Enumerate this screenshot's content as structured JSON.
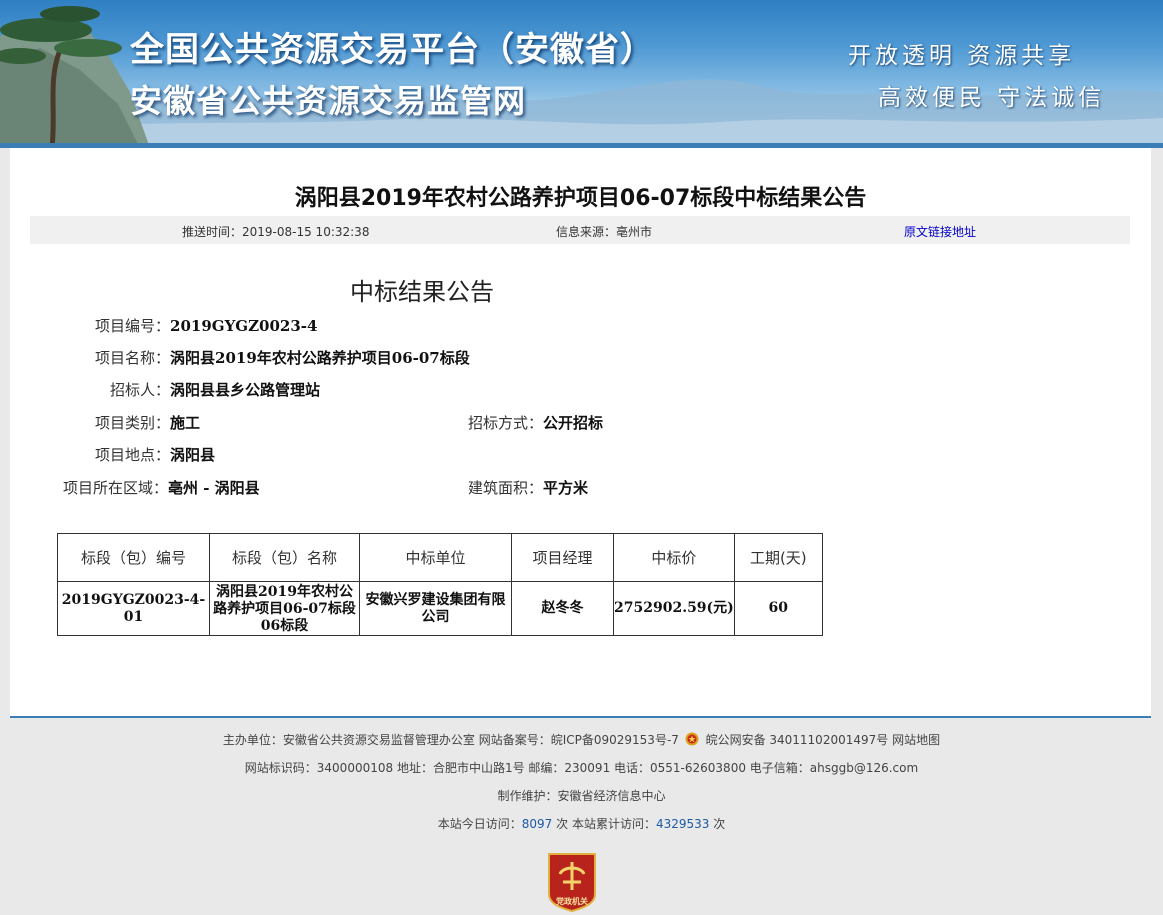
{
  "header": {
    "title": "全国公共资源交易平台（安徽省）",
    "subtitle": "安徽省公共资源交易监管网",
    "slogan_line1": "开放透明  资源共享",
    "slogan_line2": "高效便民  守法诚信"
  },
  "article": {
    "title": "涡阳县2019年农村公路养护项目06-07标段中标结果公告",
    "meta": {
      "push_time": "推送时间：2019-08-15 10:32:38",
      "source": "信息来源：亳州市",
      "original_link": "原文链接地址"
    },
    "notice_title": "中标结果公告",
    "fields": {
      "project_no_label": "项目编号：",
      "project_no": "2019GYGZ0023-4",
      "project_name_label": "项目名称：",
      "project_name": "涡阳县2019年农村公路养护项目06-07标段",
      "tenderer_label": "招标人：",
      "tenderer": "涡阳县县乡公路管理站",
      "category_label": "项目类别：",
      "category": "施工",
      "method_label": "招标方式：",
      "method": "公开招标",
      "location_label": "项目地点：",
      "location": "涡阳县",
      "region_label": "项目所在区域：",
      "region": "亳州 - 涡阳县",
      "area_label": "建筑面积：",
      "area": "平方米"
    },
    "table": {
      "headers": [
        "标段（包）编号",
        "标段（包）名称",
        "中标单位",
        "项目经理",
        "中标价",
        "工期(天)"
      ],
      "row": {
        "section_no": "2019GYGZ0023-4-01",
        "section_name": "涡阳县2019年农村公路养护项目06-07标段06标段",
        "winner": "安徽兴罗建设集团有限公司",
        "manager": "赵冬冬",
        "price": "2752902.59(元)",
        "duration": "60"
      }
    }
  },
  "footer": {
    "line1_a": "主办单位：安徽省公共资源交易监督管理办公室   网站备案号：皖ICP备09029153号-7",
    "line1_b": "皖公网安备 34011102001497号   网站地图",
    "line2": "网站标识码：3400000108   地址：合肥市中山路1号   邮编：230091   电话：0551-62603800   电子信箱：ahsggb@126.com",
    "line3": "制作维护：安徽省经济信息中心",
    "visits_today_label": "本站今日访问：",
    "visits_today": "8097",
    "visits_today_unit": " 次     本站累计访问：",
    "visits_total": "4329533",
    "visits_total_unit": " 次",
    "badge_text": "党政机关"
  },
  "colors": {
    "banner_blue": "#2f7fc3",
    "link_blue": "#0000cc",
    "counter_blue": "#1a5aa8",
    "badge_red": "#b8231b"
  },
  "icons": [
    "pine-tree-icon",
    "police-emblem-icon",
    "party-gov-badge-icon"
  ]
}
